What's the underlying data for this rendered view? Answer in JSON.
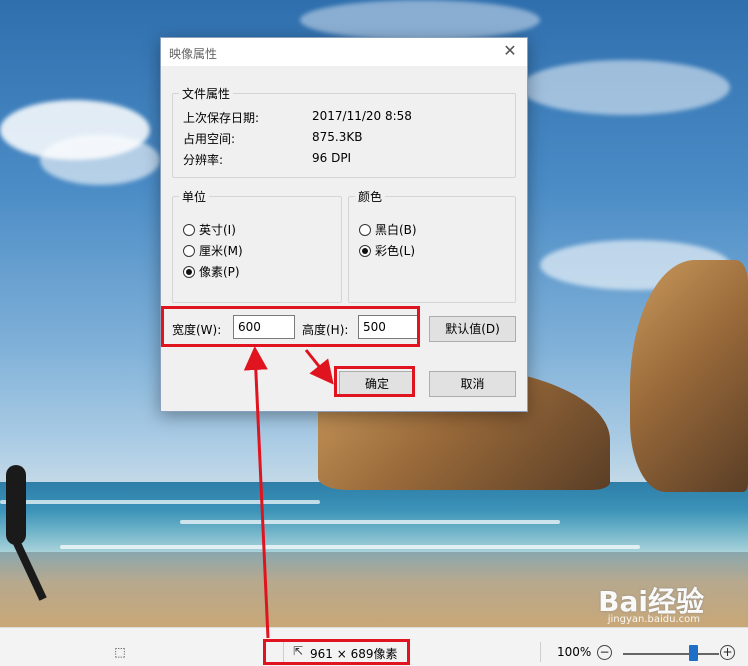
{
  "dialog": {
    "title": "映像属性",
    "close_icon": "close-icon",
    "file_props": {
      "legend": "文件属性",
      "rows": [
        {
          "label": "上次保存日期:",
          "value": "2017/11/20 8:58"
        },
        {
          "label": "占用空间:",
          "value": "875.3KB"
        },
        {
          "label": "分辨率:",
          "value": "96 DPI"
        }
      ]
    },
    "unit": {
      "legend": "单位",
      "options": [
        {
          "label": "英寸(I)",
          "checked": false
        },
        {
          "label": "厘米(M)",
          "checked": false
        },
        {
          "label": "像素(P)",
          "checked": true
        }
      ]
    },
    "color": {
      "legend": "颜色",
      "options": [
        {
          "label": "黑白(B)",
          "checked": false
        },
        {
          "label": "彩色(L)",
          "checked": true
        }
      ]
    },
    "width_label": "宽度(W):",
    "width_value": "600",
    "height_label": "高度(H):",
    "height_value": "500",
    "default_button": "默认值(D)",
    "ok_button": "确定",
    "cancel_button": "取消"
  },
  "statusbar": {
    "dimensions": "961 × 689像素",
    "zoom": "100%",
    "zoom_out": "−",
    "zoom_in": "+",
    "zoom_level_fraction": 0.7,
    "icons": [
      "select-region-icon",
      "image-size-icon"
    ]
  },
  "watermark": {
    "text": "Bai经验",
    "sub": "jingyan.baidu.com"
  },
  "colors": {
    "highlight": "#e0141f",
    "accent": "#1f6fc7"
  }
}
